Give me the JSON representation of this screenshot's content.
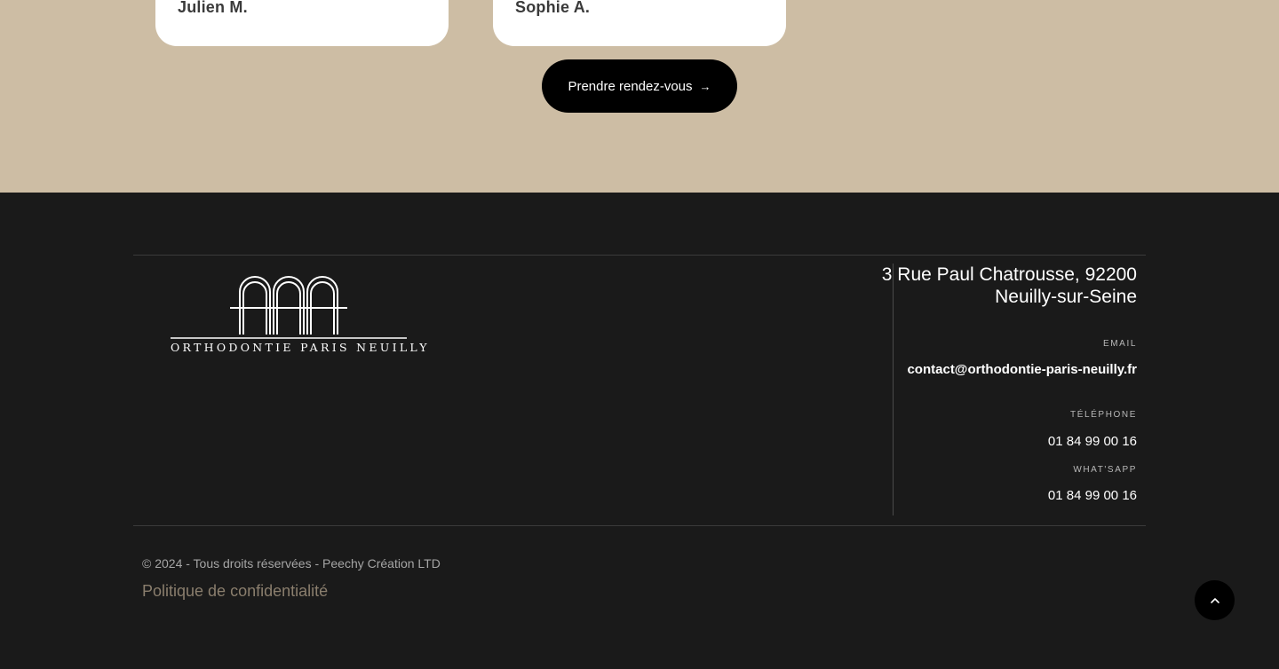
{
  "testimonials": [
    {
      "name": "Julien M."
    },
    {
      "name": "Sophie A."
    }
  ],
  "cta": {
    "label": "Prendre rendez-vous",
    "arrow": "→"
  },
  "footer": {
    "logo_text": "ORTHODONTIE PARIS NEUILLY",
    "address": "3 Rue Paul Chatrousse, 92200 Neuilly-sur-Seine",
    "email": {
      "label": "EMAIL",
      "value": "contact@orthodontie-paris-neuilly.fr"
    },
    "telephone": {
      "label": "TÉLÉPHONE",
      "value": "01 84 99 00 16"
    },
    "whatsapp": {
      "label": "WHAT'SAPP",
      "value": "01 84 99 00 16"
    },
    "copyright": "© 2024 - Tous droits réservées - Peechy Création LTD",
    "privacy_link": "Politique de confidentialité",
    "scroll_top_icon": "chevron-up-icon"
  },
  "colors": {
    "beige": "#cdbda4",
    "footer_bg": "#1a1a1a",
    "policy_link": "#8a7e6d"
  }
}
